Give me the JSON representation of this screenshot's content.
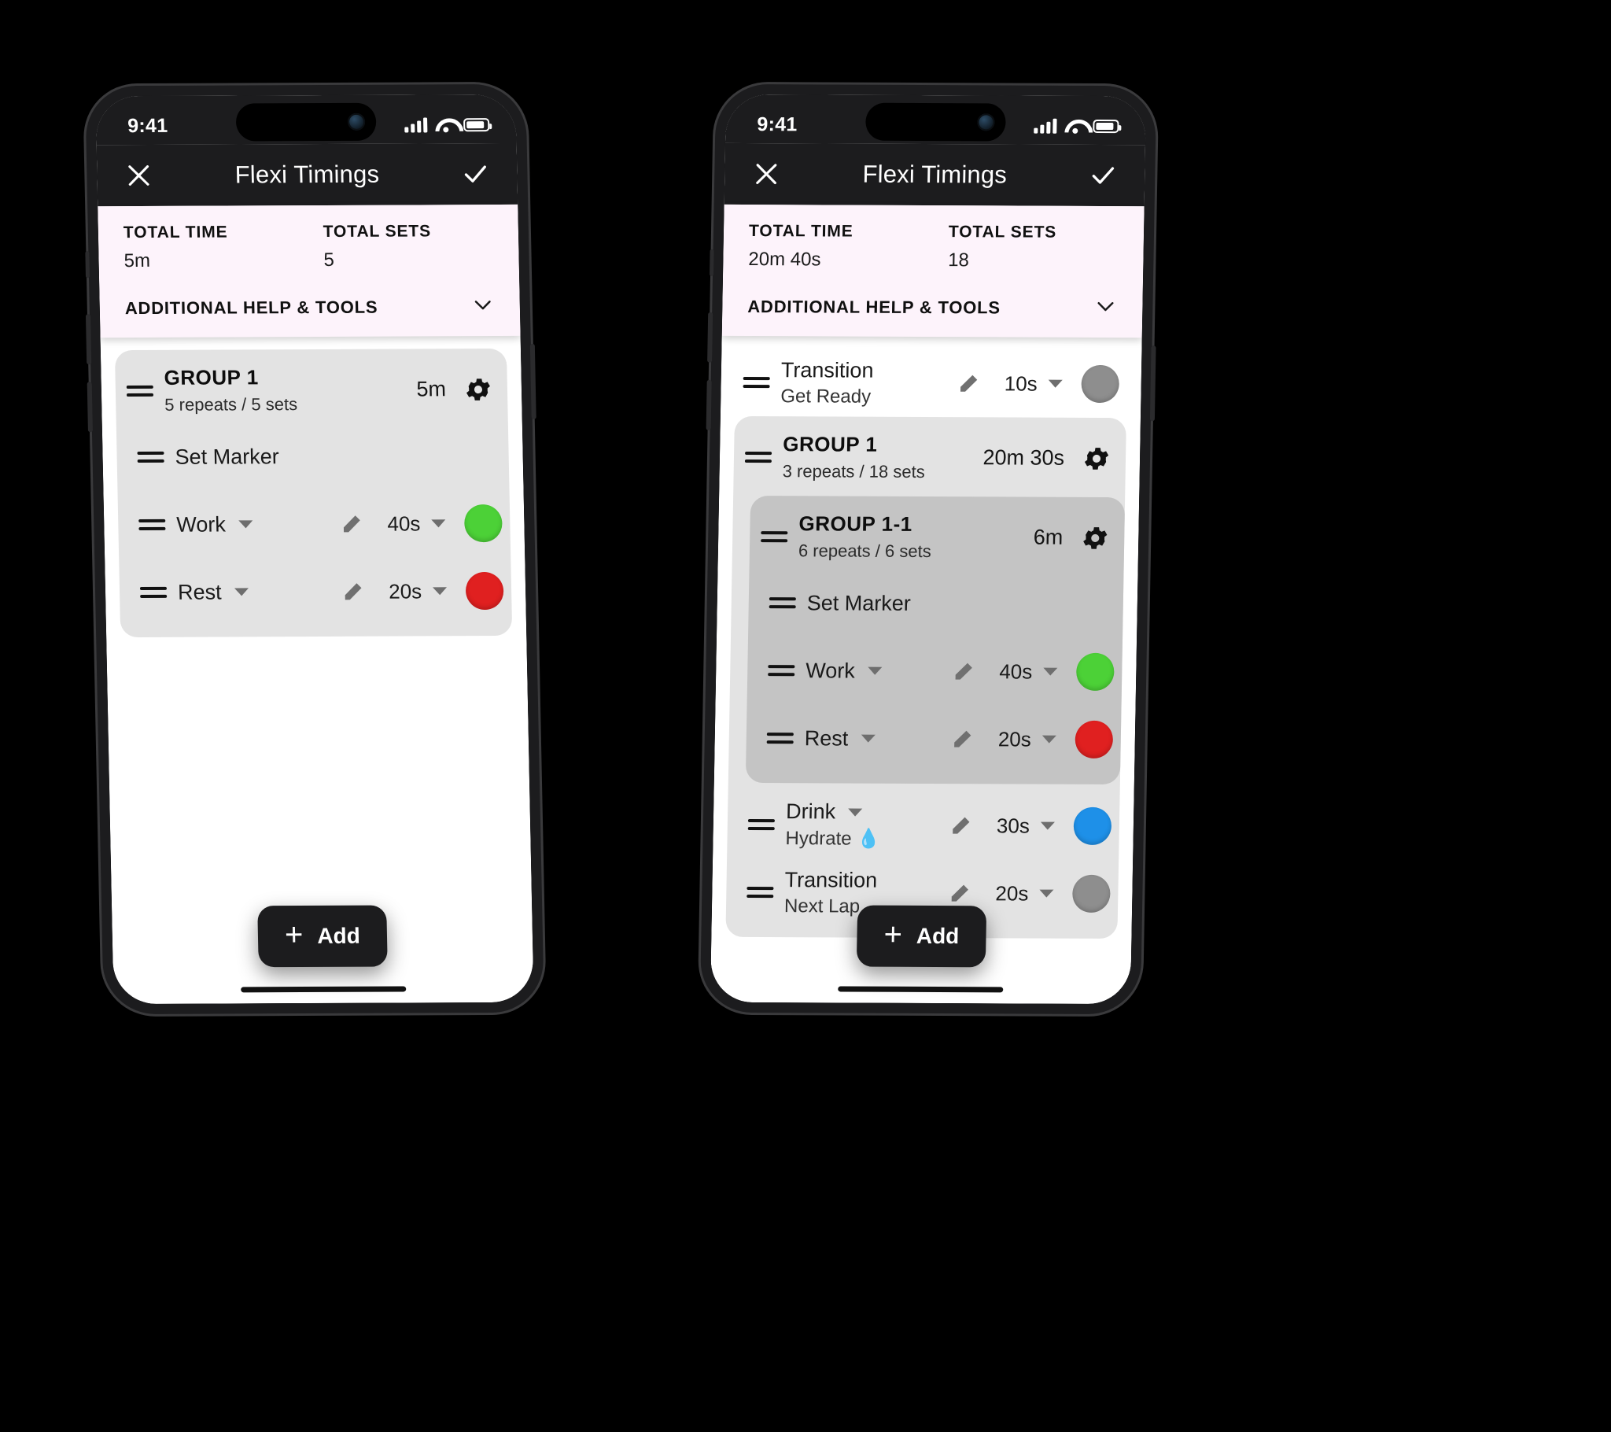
{
  "status_bar": {
    "time": "9:41",
    "signal_icon": "cellular-bars-icon",
    "wifi_icon": "wifi-icon",
    "battery_icon": "battery-icon"
  },
  "app_bar": {
    "title": "Flexi Timings",
    "close_icon": "close-icon",
    "confirm_icon": "check-icon"
  },
  "labels": {
    "total_time": "TOTAL TIME",
    "total_sets": "TOTAL SETS",
    "additional_help": "ADDITIONAL HELP & TOOLS",
    "expand_icon": "chevron-down-icon",
    "gear_icon": "gear-icon",
    "pencil_icon": "pencil-icon",
    "grip_icon": "drag-handle-icon",
    "caret_icon": "caret-down-icon"
  },
  "fab": {
    "label": "Add",
    "icon": "plus-icon"
  },
  "colors": {
    "work": "#4cd137",
    "rest": "#e02020",
    "drink": "#1e90e8",
    "transition": "#8e8e8e",
    "panel": "#fdf3fb",
    "group_l1": "#e3e3e3",
    "group_l2": "#c4c4c4",
    "appbar": "#1c1c1e"
  },
  "phone_left": {
    "total_time_value": "5m",
    "total_sets_value": "5",
    "items": [
      {
        "kind": "group",
        "level": 1,
        "name": "GROUP 1",
        "sub": "5 repeats / 5 sets",
        "time": "5m",
        "children": [
          {
            "kind": "marker",
            "title": "Set Marker"
          },
          {
            "kind": "interval",
            "title": "Work",
            "duration": "40s",
            "color": "#4cd137"
          },
          {
            "kind": "interval",
            "title": "Rest",
            "duration": "20s",
            "color": "#e02020"
          }
        ]
      }
    ]
  },
  "phone_right": {
    "total_time_value": "20m 40s",
    "total_sets_value": "18",
    "items": [
      {
        "kind": "interval",
        "title": "Transition",
        "sub": "Get Ready",
        "duration": "10s",
        "color": "#8e8e8e"
      },
      {
        "kind": "group",
        "level": 1,
        "name": "GROUP 1",
        "sub": "3 repeats / 18 sets",
        "time": "20m 30s",
        "children": [
          {
            "kind": "group",
            "level": 2,
            "name": "GROUP 1-1",
            "sub": "6 repeats / 6 sets",
            "time": "6m",
            "children": [
              {
                "kind": "marker",
                "title": "Set Marker"
              },
              {
                "kind": "interval",
                "title": "Work",
                "duration": "40s",
                "color": "#4cd137"
              },
              {
                "kind": "interval",
                "title": "Rest",
                "duration": "20s",
                "color": "#e02020"
              }
            ]
          },
          {
            "kind": "interval",
            "title": "Drink",
            "sub": "Hydrate 💧",
            "duration": "30s",
            "color": "#1e90e8"
          },
          {
            "kind": "interval",
            "title": "Transition",
            "sub": "Next Lap",
            "duration": "20s",
            "color": "#8e8e8e"
          }
        ]
      }
    ]
  }
}
